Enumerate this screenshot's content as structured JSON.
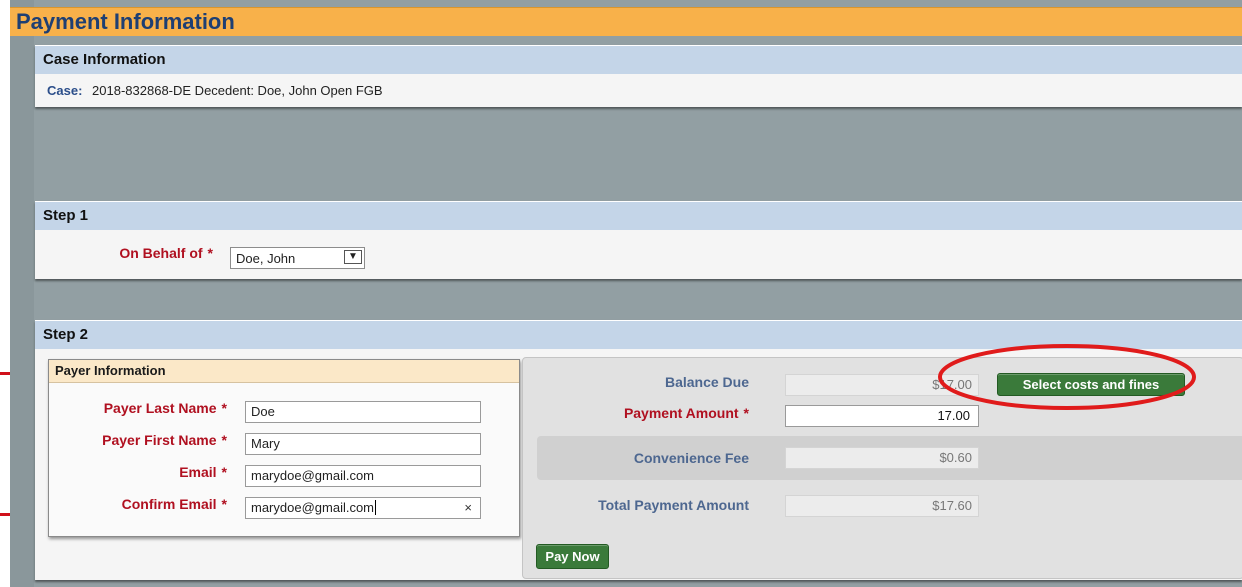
{
  "page_title": "Payment Information",
  "case_panel": {
    "header": "Case Information",
    "case_label": "Case:",
    "case_value": "2018-832868-DE Decedent: Doe, John Open FGB"
  },
  "step1": {
    "header": "Step 1",
    "on_behalf_label": "On Behalf of",
    "required_marker": "*",
    "on_behalf_value": "Doe, John"
  },
  "step2": {
    "header": "Step 2",
    "payer": {
      "header": "Payer Information",
      "last_name_label": "Payer Last Name",
      "last_name_value": "Doe",
      "first_name_label": "Payer First Name",
      "first_name_value": "Mary",
      "email_label": "Email",
      "email_value": "marydoe@gmail.com",
      "confirm_email_label": "Confirm Email",
      "confirm_email_value": "marydoe@gmail.com",
      "clear_symbol": "×"
    },
    "payment": {
      "balance_due_label": "Balance Due",
      "balance_due_value": "$17.00",
      "select_costs_button": "Select costs and fines",
      "payment_amount_label": "Payment Amount",
      "payment_amount_value": "17.00",
      "convenience_fee_label": "Convenience Fee",
      "convenience_fee_value": "$0.60",
      "total_label": "Total Payment Amount",
      "total_value": "$17.60",
      "pay_now_button": "Pay Now"
    }
  },
  "colors": {
    "title_bar": "#f8b14a",
    "title_text": "#1e3f73",
    "panel_header": "#c4d5e8",
    "required_red": "#b01020",
    "button_green": "#3a7a3a",
    "annotation_red": "#e01b1b"
  }
}
